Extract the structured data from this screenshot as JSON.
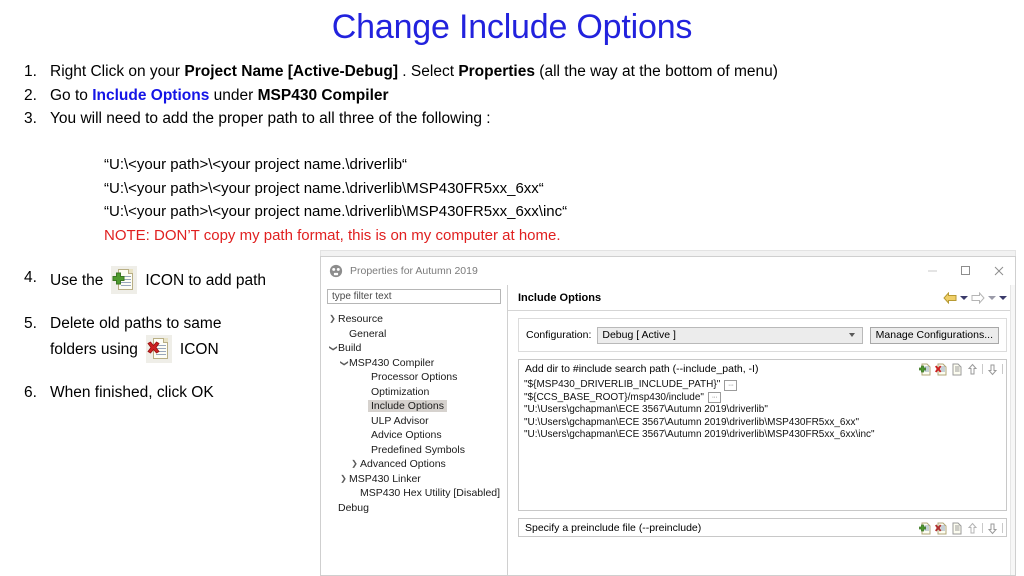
{
  "slide": {
    "title": "Change Include Options",
    "title_color": "#2222dd",
    "steps_top": [
      {
        "num": "1.",
        "parts": [
          {
            "t": "Right Click on your ",
            "s": "normal"
          },
          {
            "t": "Project Name [Active-Debug]",
            "s": "bold"
          },
          {
            "t": " .  Select  ",
            "s": "normal"
          },
          {
            "t": "Properties",
            "s": "bold"
          },
          {
            "t": " (all the way at the bottom of menu)",
            "s": "normal"
          }
        ]
      },
      {
        "num": "2.",
        "parts": [
          {
            "t": "Go to ",
            "s": "normal"
          },
          {
            "t": "Include Options",
            "s": "blue"
          },
          {
            "t": " under ",
            "s": "normal"
          },
          {
            "t": "MSP430 Compiler",
            "s": "bold"
          }
        ]
      },
      {
        "num": "3.",
        "parts": [
          {
            "t": "You will need to add the proper path to all three of the following :",
            "s": "normal"
          }
        ]
      }
    ],
    "paths": [
      "“U:\\<your path>\\<your project name.\\driverlib“",
      "“U:\\<your path>\\<your project name.\\driverlib\\MSP430FR5xx_6xx“",
      "“U:\\<your path>\\<your project name.\\driverlib\\MSP430FR5xx_6xx\\inc“"
    ],
    "note": "NOTE: DON’T copy my path format, this is on my computer at home.",
    "note_color": "#e02020",
    "steps_bottom": [
      {
        "num": "4.",
        "before": "Use the",
        "icon": "add-path-icon",
        "after": "ICON to add path"
      },
      {
        "num": "5.",
        "line1": "Delete old paths to same",
        "before": "folders using",
        "icon": "delete-path-icon",
        "after": "ICON"
      },
      {
        "num": "6.",
        "text": "When finished, click OK"
      }
    ]
  },
  "dialog": {
    "title": "Properties for Autumn 2019",
    "window_buttons": {
      "minimize": "—",
      "maximize": "☐",
      "close": "✕"
    },
    "filter_placeholder": "type filter text",
    "tree": [
      {
        "label": "Resource",
        "indent": 0,
        "twisty": "collapsed",
        "selected": false
      },
      {
        "label": "General",
        "indent": 1,
        "twisty": "none",
        "selected": false
      },
      {
        "label": "Build",
        "indent": 0,
        "twisty": "expanded",
        "selected": false
      },
      {
        "label": "MSP430 Compiler",
        "indent": 1,
        "twisty": "expanded",
        "selected": false
      },
      {
        "label": "Processor Options",
        "indent": 3,
        "twisty": "none",
        "selected": false
      },
      {
        "label": "Optimization",
        "indent": 3,
        "twisty": "none",
        "selected": false
      },
      {
        "label": "Include Options",
        "indent": 3,
        "twisty": "none",
        "selected": true
      },
      {
        "label": "ULP Advisor",
        "indent": 3,
        "twisty": "none",
        "selected": false
      },
      {
        "label": "Advice Options",
        "indent": 3,
        "twisty": "none",
        "selected": false
      },
      {
        "label": "Predefined Symbols",
        "indent": 3,
        "twisty": "none",
        "selected": false
      },
      {
        "label": "Advanced Options",
        "indent": 2,
        "twisty": "collapsed",
        "selected": false
      },
      {
        "label": "MSP430 Linker",
        "indent": 1,
        "twisty": "collapsed",
        "selected": false
      },
      {
        "label": "MSP430 Hex Utility  [Disabled]",
        "indent": 2,
        "twisty": "none",
        "selected": false
      },
      {
        "label": "Debug",
        "indent": 0,
        "twisty": "none",
        "selected": false
      }
    ],
    "page_title": "Include Options",
    "config_label": "Configuration:",
    "config_value": "Debug  [ Active ]",
    "manage_configurations_label": "Manage Configurations...",
    "include_panel": {
      "title": "Add dir to #include search path (--include_path, -I)",
      "tools": [
        "add-icon",
        "delete-icon",
        "edit-icon",
        "move-up-icon",
        "move-down-icon"
      ],
      "items": [
        {
          "text": "\"${MSP430_DRIVERLIB_INCLUDE_PATH}\"",
          "chip": "···"
        },
        {
          "text": "\"${CCS_BASE_ROOT}/msp430/include\"",
          "chip": "···"
        },
        {
          "text": "\"U:\\Users\\gchapman\\ECE 3567\\Autumn 2019\\driverlib\"",
          "chip": ""
        },
        {
          "text": "\"U:\\Users\\gchapman\\ECE 3567\\Autumn 2019\\driverlib\\MSP430FR5xx_6xx\"",
          "chip": ""
        },
        {
          "text": "\"U:\\Users\\gchapman\\ECE 3567\\Autumn 2019\\driverlib\\MSP430FR5xx_6xx\\inc\"",
          "chip": ""
        }
      ]
    },
    "preinclude_panel": {
      "title": "Specify a preinclude file (--preinclude)",
      "tools": [
        "add-icon",
        "delete-icon",
        "edit-icon",
        "move-up-icon",
        "move-down-icon"
      ]
    }
  }
}
